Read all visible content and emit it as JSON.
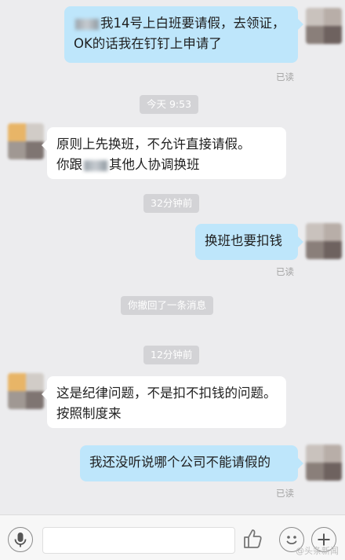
{
  "messages": [
    {
      "side": "me",
      "pre": "",
      "text": "我14号上白班要请假，去领证，OK的话我在钉钉上申请了",
      "read": "已读"
    },
    {
      "side": "them",
      "line1": "原则上先换班，不允许直接请假。",
      "line2_pre": "你跟",
      "line2_post": "其他人协调换班"
    },
    {
      "side": "me",
      "text": "换班也要扣钱",
      "read": "已读"
    },
    {
      "side": "them",
      "text": "这是纪律问题，不是扣不扣钱的问题。按照制度来"
    },
    {
      "side": "me",
      "text": "我还没听说哪个公司不能请假的",
      "read": "已读"
    }
  ],
  "timestamps": [
    "今天 9:53",
    "32分钟前",
    "12分钟前"
  ],
  "system_notice": "你撤回了一条消息",
  "input_bar": {
    "voice_icon": "microphone-icon",
    "like_icon": "thumbs-up-icon",
    "emoji_icon": "smiley-icon",
    "plus_icon": "plus-icon"
  },
  "watermark": "@头条新闻",
  "colors": {
    "my_bubble": "#bee6fb",
    "their_bubble": "#ffffff",
    "background": "#ececee"
  }
}
